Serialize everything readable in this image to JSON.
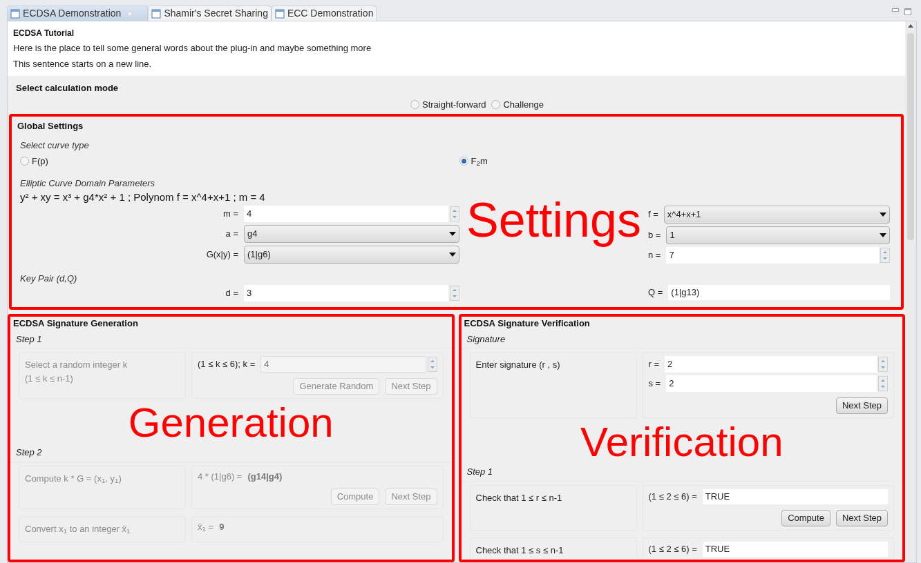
{
  "tabs": [
    {
      "label": "ECDSA Demonstration",
      "selected": true
    },
    {
      "label": "Shamir's Secret Sharing",
      "selected": false
    },
    {
      "label": "ECC Demonstration",
      "selected": false
    }
  ],
  "tutorial": {
    "title": "ECDSA Tutorial",
    "lines": [
      "Here is the place to tell some general words about the plug-in and maybe something more",
      "This sentence starts on a new line."
    ]
  },
  "mode": {
    "title": "Select calculation mode",
    "options": [
      {
        "label": "Straight-forward",
        "selected": false
      },
      {
        "label": "Challenge",
        "selected": false
      }
    ]
  },
  "settings": {
    "annotation": "Settings",
    "title": "Global Settings",
    "curve_type": {
      "title": "Select curve type",
      "options": [
        {
          "label": "F(p)",
          "selected": false
        },
        {
          "label": "F$_{2}$m",
          "selected": true
        }
      ]
    },
    "domain": {
      "title": "Elliptic Curve Domain Parameters",
      "equation": "y² + xy = x³ + g4*x² + 1 ; Polynom f = x^4+x+1 ; m = 4",
      "left_fields": [
        {
          "label": "m =",
          "value": "4",
          "kind": "spinner"
        },
        {
          "label": "a =",
          "value": "g4",
          "kind": "dropdown"
        },
        {
          "label": "G(x|y) =",
          "value": "(1|g6)",
          "kind": "dropdown"
        }
      ],
      "right_fields": [
        {
          "label": "f =",
          "value": "x^4+x+1",
          "kind": "dropdown"
        },
        {
          "label": "b =",
          "value": "1",
          "kind": "dropdown"
        },
        {
          "label": "n =",
          "value": "7",
          "kind": "spinner"
        }
      ]
    },
    "key_pair": {
      "title": "Key Pair (d,Q)",
      "left_fields": [
        {
          "label": "d =",
          "value": "3",
          "kind": "spinner"
        }
      ],
      "right_fields": [
        {
          "label": "Q =",
          "value": "(1|g13)",
          "kind": "text"
        }
      ]
    }
  },
  "generation": {
    "annotation": "Generation",
    "title": "ECDSA Signature Generation",
    "steps": [
      {
        "title": "Step 1",
        "rows": [
          {
            "description": [
              "Select a random integer k",
              "(1 ≤ k ≤ n-1)"
            ],
            "disabled": true,
            "fields": [
              {
                "label": "(1 ≤ k ≤ 6); k =",
                "value": "4",
                "kind": "spinner",
                "label_disabled": false,
                "disabled": true
              }
            ],
            "buttons": [
              {
                "label": "Generate Random",
                "disabled": true
              },
              {
                "label": "Next Step",
                "disabled": true
              }
            ]
          }
        ]
      },
      {
        "title": "Step 2",
        "rows": [
          {
            "description": [
              "Compute k * G = (x$_{1}$, y$_{1}$)"
            ],
            "disabled": true,
            "fields": [
              {
                "label": "4 * (1|g6) =",
                "value": "(g14|g4)",
                "kind": "plain",
                "label_disabled": true,
                "disabled": true
              }
            ],
            "buttons": [
              {
                "label": "Compute",
                "disabled": true
              },
              {
                "label": "Next Step",
                "disabled": true
              }
            ]
          },
          {
            "description": [
              "Convert x$_{1}$ to an integer x̄$_{1}$"
            ],
            "disabled": true,
            "fields": [
              {
                "label": "x̄$_{1}$ =",
                "value": "9",
                "kind": "plain",
                "label_disabled": true,
                "disabled": true
              }
            ]
          }
        ]
      }
    ]
  },
  "verification": {
    "annotation": "Verification",
    "title": "ECDSA Signature Verification",
    "steps": [
      {
        "title": "Signature",
        "rows": [
          {
            "description": [
              "Enter signature (r , s)"
            ],
            "disabled": false,
            "fields": [
              {
                "label": "r  =",
                "value": "2",
                "kind": "spinner",
                "label_disabled": false,
                "disabled": false
              },
              {
                "label": "s  =",
                "value": "2",
                "kind": "spinner",
                "label_disabled": false,
                "disabled": false
              }
            ],
            "buttons": [
              {
                "label": "Next Step",
                "disabled": false
              }
            ]
          }
        ]
      },
      {
        "title": "Step 1",
        "rows": [
          {
            "description": [
              "Check that 1 ≤ r ≤ n-1"
            ],
            "disabled": false,
            "fields": [
              {
                "label": "(1 ≤ 2 ≤ 6) =",
                "value": "TRUE",
                "kind": "text",
                "label_disabled": false,
                "disabled": false
              }
            ],
            "buttons": [
              {
                "label": "Compute",
                "disabled": false
              },
              {
                "label": "Next Step",
                "disabled": false
              }
            ]
          },
          {
            "description": [
              "Check that 1 ≤ s ≤ n-1"
            ],
            "disabled": false,
            "fields": [
              {
                "label": "(1 ≤ 2 ≤ 6) =",
                "value": "TRUE",
                "kind": "text",
                "label_disabled": false,
                "disabled": false
              }
            ]
          }
        ]
      }
    ]
  }
}
